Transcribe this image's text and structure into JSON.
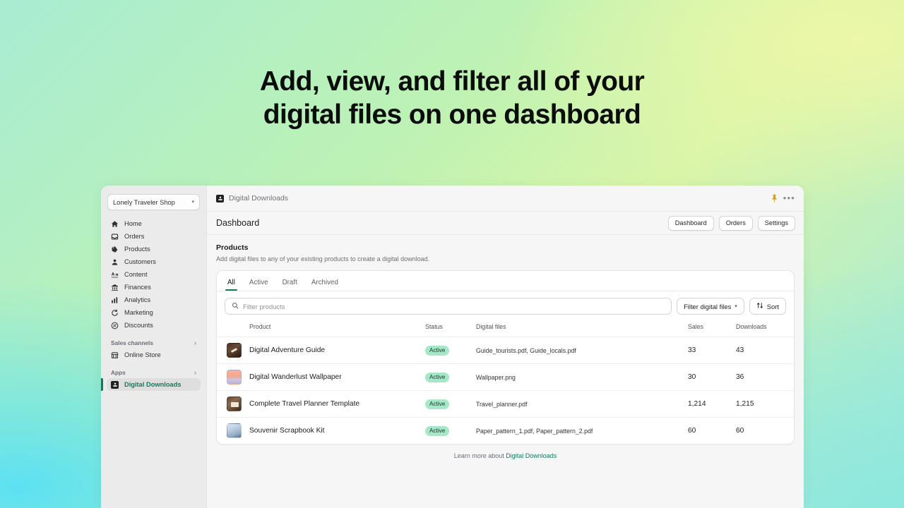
{
  "headline": {
    "line1": "Add, view, and filter all of your",
    "line2": "digital files on one dashboard"
  },
  "colors": {
    "accent_green": "#0f7a5e",
    "badge_bg": "#a4e8c8",
    "pin_gold": "#d99a16",
    "window_bg": "#f6f6f7",
    "sidebar_bg": "#ebebeb"
  },
  "sidebar": {
    "shop_selector": {
      "label": "Lonely Traveler Shop",
      "icon": "chevron-down-icon"
    },
    "items": [
      {
        "label": "Home",
        "icon": "home-icon"
      },
      {
        "label": "Orders",
        "icon": "orders-icon"
      },
      {
        "label": "Products",
        "icon": "tag-icon"
      },
      {
        "label": "Customers",
        "icon": "person-icon"
      },
      {
        "label": "Content",
        "icon": "content-icon"
      },
      {
        "label": "Finances",
        "icon": "bank-icon"
      },
      {
        "label": "Analytics",
        "icon": "bar-chart-icon"
      },
      {
        "label": "Marketing",
        "icon": "megaphone-icon"
      },
      {
        "label": "Discounts",
        "icon": "discount-icon"
      }
    ],
    "sections": [
      {
        "label": "Sales channels",
        "chevron": "›",
        "items": [
          {
            "label": "Online Store",
            "icon": "storefront-icon"
          }
        ]
      },
      {
        "label": "Apps",
        "chevron": "›",
        "items": [
          {
            "label": "Digital Downloads",
            "icon": "digital-downloads-app-icon",
            "active": true
          }
        ]
      }
    ]
  },
  "appbar": {
    "title": "Digital Downloads",
    "app_icon": "digital-downloads-app-icon",
    "pin_icon": "pin-icon",
    "more_icon": "more-horizontal-icon",
    "more_label": "•••"
  },
  "pagebar": {
    "title": "Dashboard",
    "buttons": [
      {
        "label": "Dashboard"
      },
      {
        "label": "Orders"
      },
      {
        "label": "Settings"
      }
    ]
  },
  "section": {
    "title": "Products",
    "subtitle": "Add digital files to any of your existing products to create a digital download."
  },
  "tabs": [
    {
      "label": "All",
      "selected": true
    },
    {
      "label": "Active",
      "selected": false
    },
    {
      "label": "Draft",
      "selected": false
    },
    {
      "label": "Archived",
      "selected": false
    }
  ],
  "filters": {
    "search_placeholder": "Filter products",
    "search_value": "",
    "search_icon": "search-icon",
    "filter_files_label": "Filter digital files",
    "filter_files_caret": "▾",
    "sort_label": "Sort",
    "sort_icon": "sort-icon"
  },
  "table": {
    "columns": [
      "Product",
      "Status",
      "Digital files",
      "Sales",
      "Downloads"
    ],
    "rows": [
      {
        "product": "Digital Adventure Guide",
        "status": "Active",
        "files": "Guide_tourists.pdf, Guide_locals.pdf",
        "sales": "33",
        "downloads": "43",
        "thumb": "th1"
      },
      {
        "product": "Digital Wanderlust Wallpaper",
        "status": "Active",
        "files": "Wallpaper.png",
        "sales": "30",
        "downloads": "36",
        "thumb": "th2"
      },
      {
        "product": "Complete Travel Planner Template",
        "status": "Active",
        "files": "Travel_planner.pdf",
        "sales": "1,214",
        "downloads": "1,215",
        "thumb": "th3"
      },
      {
        "product": "Souvenir Scrapbook Kit",
        "status": "Active",
        "files": "Paper_pattern_1.pdf, Paper_pattern_2.pdf",
        "sales": "60",
        "downloads": "60",
        "thumb": "th4"
      }
    ]
  },
  "footer": {
    "text": "Learn more about ",
    "link": "Digital Downloads"
  }
}
